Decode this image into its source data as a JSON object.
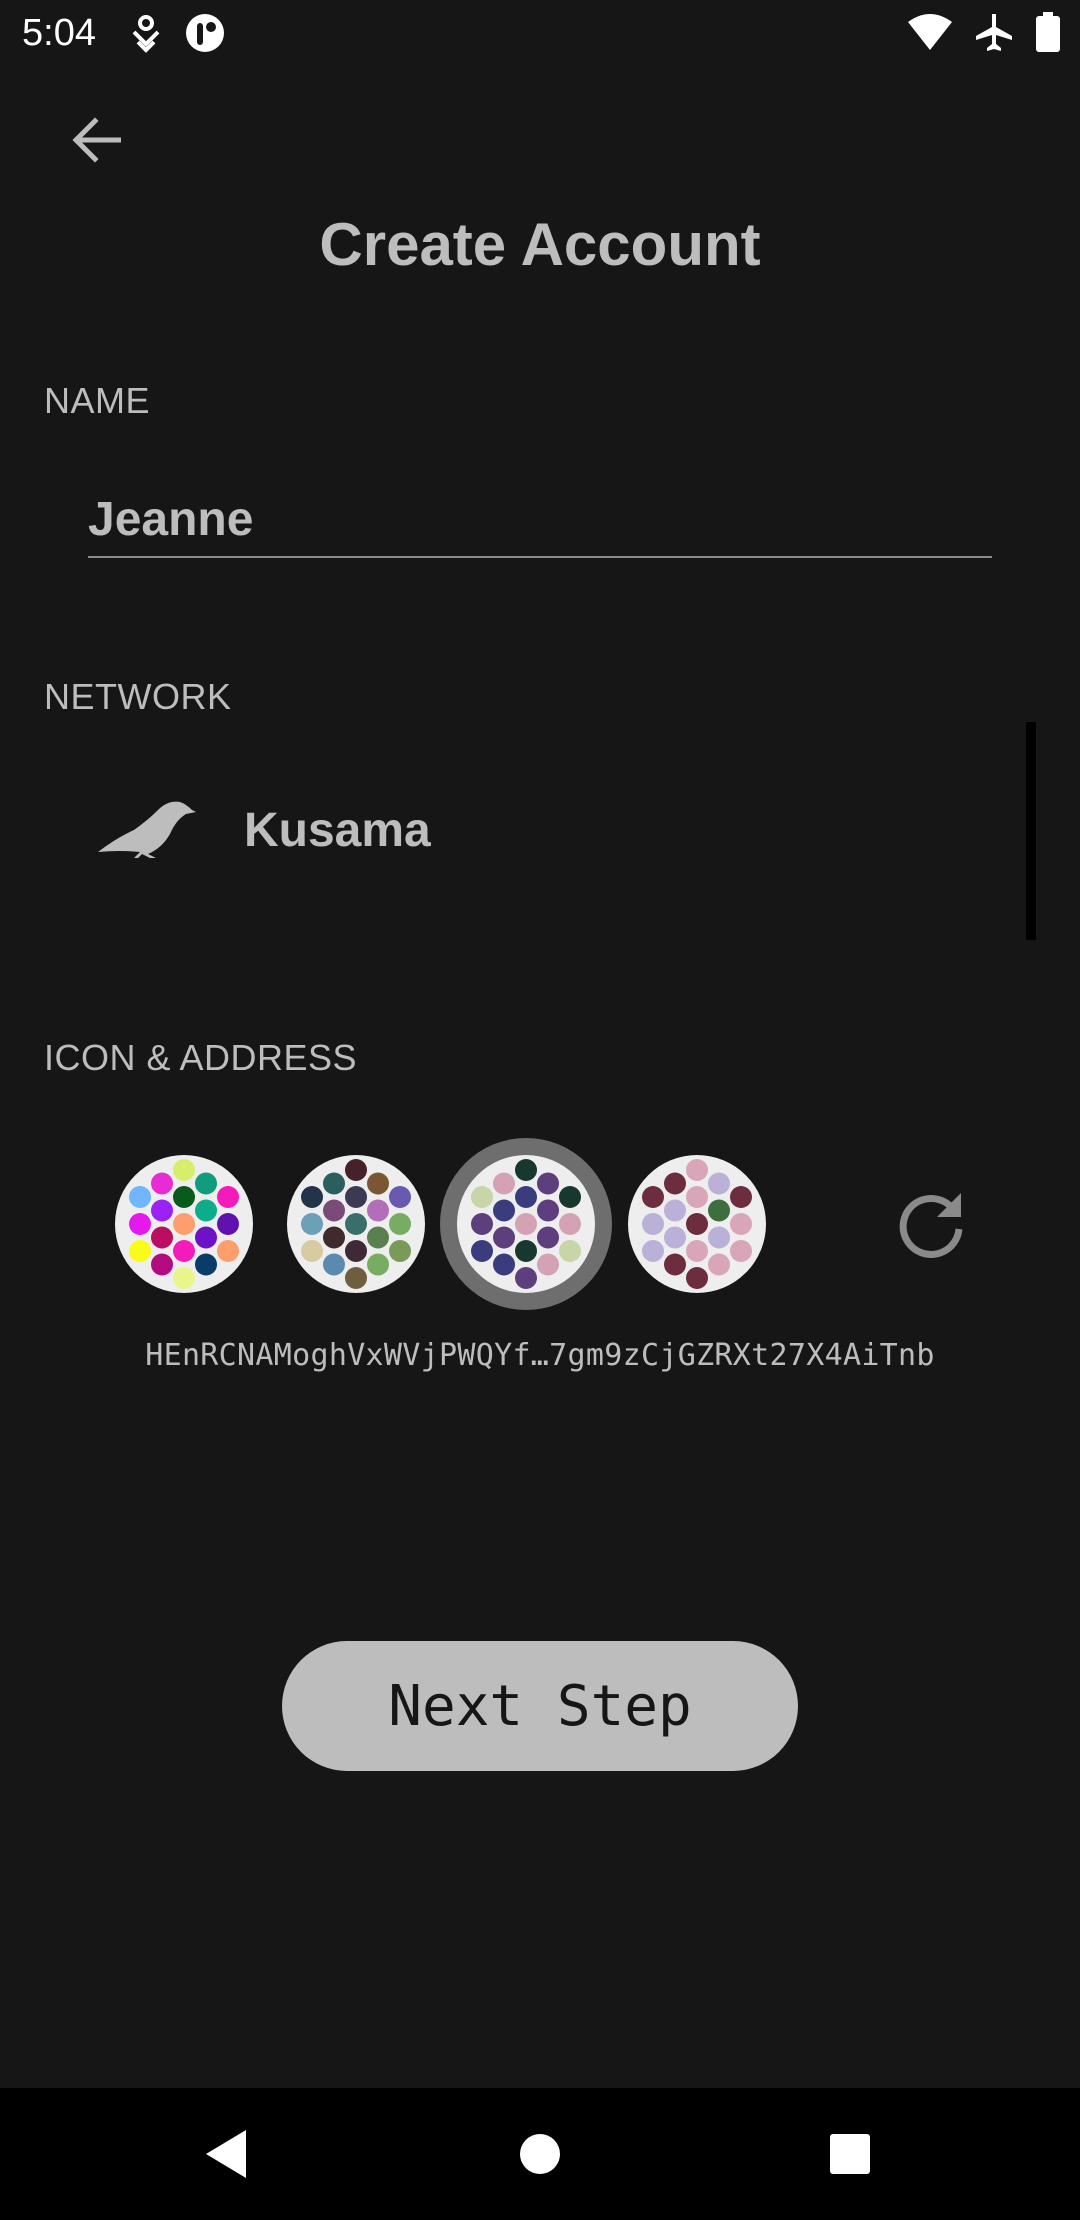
{
  "status_bar": {
    "time": "5:04",
    "left_icons": [
      "location-tracking-icon",
      "app-notification-icon"
    ],
    "right_icons": [
      "wifi-icon",
      "airplane-mode-icon",
      "battery-icon"
    ]
  },
  "header": {
    "back_icon": "arrow-left-icon",
    "title": "Create Account"
  },
  "name_section": {
    "label": "NAME",
    "value": "Jeanne"
  },
  "network_section": {
    "label": "NETWORK",
    "network_name": "Kusama",
    "network_icon": "kusama-bird-icon"
  },
  "icon_address_section": {
    "label": "ICON & ADDRESS",
    "address": "HEnRCNAMoghVxWVjPWQYf…7gm9zCjGZRXt27X4AiTnb",
    "selected_identicon_index": 2,
    "identicons": [
      {
        "colors": [
          "#d7ee6d",
          "#e82cd3",
          "#109d7d",
          "#6fb6fe",
          "#0a5a1b",
          "#f41bbb",
          "#9b22f5",
          "#0cad88",
          "#e519ed",
          "#ff9e6d",
          "#5f12ad",
          "#ba0e63",
          "#6e12c8",
          "#fbfb19",
          "#f41bbb",
          "#ff9e6d",
          "#b20c80",
          "#0a3c6a",
          "#e9f58a",
          "#9b22f5"
        ]
      },
      {
        "colors": [
          "#45212a",
          "#2b5e5e",
          "#7a5634",
          "#23334a",
          "#3c3a52",
          "#6a59b0",
          "#7a4a78",
          "#b06fb8",
          "#6c9fb8",
          "#3a6e6a",
          "#78ac62",
          "#3f2a2e",
          "#5a8050",
          "#d8cba2",
          "#3d2a36",
          "#7a9a5a",
          "#5a8ab0",
          "#78ac62",
          "#6e5e40",
          "#5a5ea8"
        ]
      },
      {
        "colors": [
          "#18372f",
          "#d5a1b5",
          "#5c3f7c",
          "#c7d5a7",
          "#3b3c7d",
          "#18372f",
          "#3b3c7d",
          "#5c3f7c",
          "#5c3f7c",
          "#d5a1b5",
          "#d5a1b5",
          "#5c3f7c",
          "#5c3f7c",
          "#3b3c7d",
          "#18372f",
          "#c7d5a7",
          "#3b3c7d",
          "#d5a1b5",
          "#5c3f7c",
          "#18372f"
        ]
      },
      {
        "colors": [
          "#d9a5b8",
          "#6c2e3e",
          "#bbb0d8",
          "#6c2e3e",
          "#d9a5b8",
          "#6c2e3e",
          "#bbb0d8",
          "#3e6e3e",
          "#bbb0d8",
          "#6c2e3e",
          "#d9a5b8",
          "#bbb0d8",
          "#bbb0d8",
          "#bbb0d8",
          "#d9a5b8",
          "#d9a5b8",
          "#6c2e3e",
          "#d9a5b8",
          "#6c2e3e",
          "#d9a5b8"
        ]
      }
    ],
    "refresh_icon": "refresh-icon"
  },
  "actions": {
    "next_label": "Next Step"
  },
  "nav_bar": {
    "icons": [
      "nav-back-icon",
      "nav-home-icon",
      "nav-recents-icon"
    ]
  }
}
